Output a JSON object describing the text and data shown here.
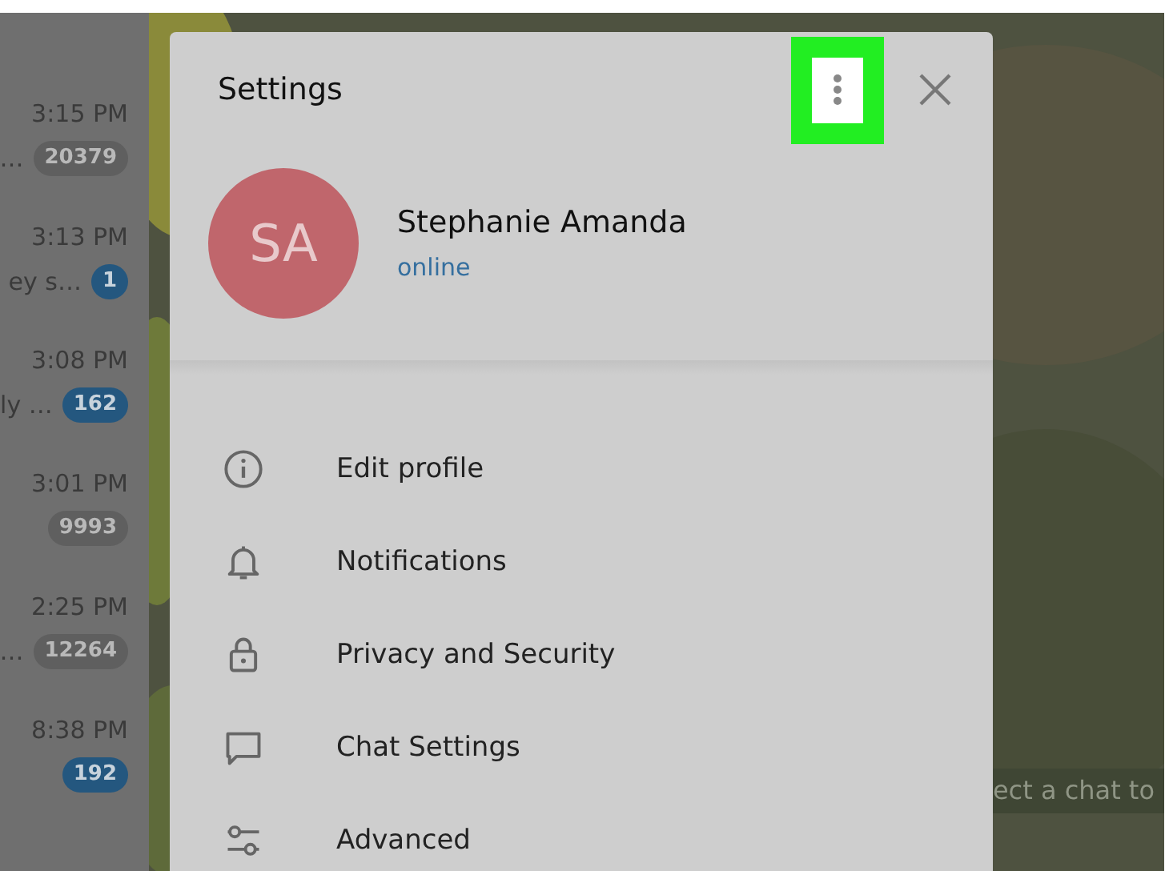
{
  "chats": [
    {
      "time": "3:15 PM",
      "preview": "…",
      "badge": "20379",
      "muted": true
    },
    {
      "time": "3:13 PM",
      "preview": "ey s…",
      "badge": "1",
      "muted": false
    },
    {
      "time": "3:08 PM",
      "preview": "ly …",
      "badge": "162",
      "muted": false
    },
    {
      "time": "3:01 PM",
      "badge": "9993",
      "muted": true
    },
    {
      "time": "2:25 PM",
      "preview": "…",
      "badge": "12264",
      "muted": true
    },
    {
      "time": "8:38 PM",
      "badge": "192",
      "muted": false
    }
  ],
  "placeholder_hint": "ect a chat to",
  "settings": {
    "title": "Settings",
    "more_highlighted": true,
    "profile": {
      "initials": "SA",
      "name": "Stephanie Amanda",
      "status": "online"
    },
    "items": [
      {
        "kind": "info",
        "label": "Edit profile"
      },
      {
        "kind": "bell",
        "label": "Notifications"
      },
      {
        "kind": "lock",
        "label": "Privacy and Security"
      },
      {
        "kind": "chat",
        "label": "Chat Settings"
      },
      {
        "kind": "sliders",
        "label": "Advanced"
      }
    ]
  }
}
